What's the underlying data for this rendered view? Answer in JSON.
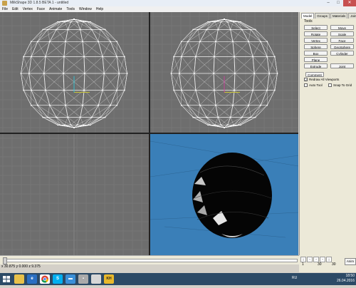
{
  "window": {
    "title": "MilkShape 3D 1.8.5 BETA 1 - untitled"
  },
  "menu": [
    "File",
    "Edit",
    "Vertex",
    "Face",
    "Animate",
    "Tools",
    "Window",
    "Help"
  ],
  "panel": {
    "tabs": [
      "Model",
      "Groups",
      "Materials",
      "Joints"
    ],
    "tools_label": "Tools",
    "buttons": [
      "Select",
      "Move",
      "Rotate",
      "Scale",
      "Vertex",
      "Face",
      "Sphere",
      "GeoSphere",
      "Box",
      "Cylinder",
      "Plane",
      "Extrude",
      "Joint"
    ],
    "comment_label": "Comment",
    "redraw_label": "Redraw All Viewports",
    "auto_tool_label": "Auto Tool",
    "snap_label": "Snap To Grid"
  },
  "status": {
    "coords": "x 30.875 y 0.000 z 9.375"
  },
  "anim": {
    "frame_start": "1",
    "frame_cur": "30",
    "frame_end": "30",
    "anim_label": "Anim"
  },
  "taskbar": {
    "lang": "RU",
    "time": "18:50",
    "date": "26.04.2016",
    "kh_label": "KH"
  },
  "colors": {
    "viewport_bg": "#6e6e6e",
    "grid": "#7c7c7c",
    "perspective_bg": "#3a7fb8",
    "panel_bg": "#ece9d8",
    "taskbar": "#2c4a66"
  }
}
